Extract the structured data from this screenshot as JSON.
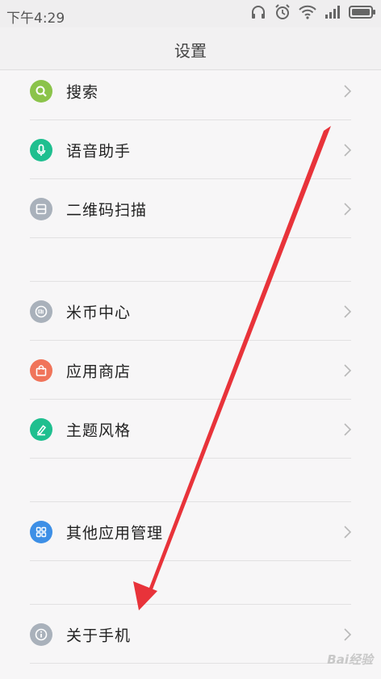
{
  "status": {
    "time": "下午4:29",
    "icons": [
      "headphones-icon",
      "alarm-icon",
      "wifi-icon",
      "signal-icon",
      "battery-icon"
    ]
  },
  "header": {
    "title": "设置"
  },
  "items": [
    {
      "label": "搜索",
      "icon": "search-icon",
      "color": "#8bc34a"
    },
    {
      "label": "语音助手",
      "icon": "microphone-icon",
      "color": "#1fbf8f"
    },
    {
      "label": "二维码扫描",
      "icon": "qr-scan-icon",
      "color": "#a9b1bb"
    },
    {
      "label": "米币中心",
      "icon": "mi-coin-icon",
      "color": "#a9b1bb"
    },
    {
      "label": "应用商店",
      "icon": "shopping-bag-icon",
      "color": "#f0745a"
    },
    {
      "label": "主题风格",
      "icon": "brush-icon",
      "color": "#1fbf8f"
    },
    {
      "label": "其他应用管理",
      "icon": "apps-grid-icon",
      "color": "#3d8fe6"
    },
    {
      "label": "关于手机",
      "icon": "info-icon",
      "color": "#a9b1bb"
    }
  ],
  "overlay": {
    "arrow_color": "#e8333a"
  },
  "watermark": "Bai经验"
}
